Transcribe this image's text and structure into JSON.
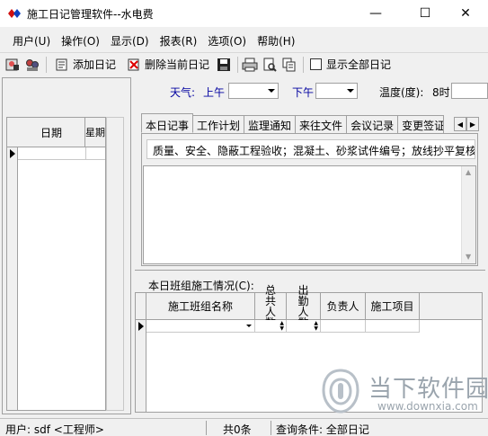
{
  "window": {
    "title": "施工日记管理软件--水电费",
    "minimize_glyph": "—",
    "maximize_glyph": "☐",
    "close_glyph": "✕"
  },
  "menu": [
    {
      "label": "用户(U)"
    },
    {
      "label": "操作(O)"
    },
    {
      "label": "显示(D)"
    },
    {
      "label": "报表(R)"
    },
    {
      "label": "选项(O)"
    },
    {
      "label": "帮助(H)"
    }
  ],
  "toolbar": {
    "add_label": "添加日记",
    "delete_label": "删除当前日记",
    "show_all_label": "显示全部日记",
    "show_all_checked": false
  },
  "left_grid": {
    "date_header": "日期",
    "week_header": "星期"
  },
  "weather": {
    "label": "天气:",
    "am_label": "上午",
    "am_value": "",
    "pm_label": "下午",
    "pm_value": "",
    "temp_label": "温度(度):",
    "temp_time": "8时"
  },
  "tabs": [
    {
      "label": "本日记事",
      "active": true
    },
    {
      "label": "工作计划",
      "active": false
    },
    {
      "label": "监理通知",
      "active": false
    },
    {
      "label": "来往文件",
      "active": false
    },
    {
      "label": "会议记录",
      "active": false
    },
    {
      "label": "变更签证",
      "active": false
    }
  ],
  "tab_content": {
    "categories": "质量、安全、隐蔽工程验收；混凝土、砂浆试件编号；放线抄平复核；",
    "notes": ""
  },
  "crew": {
    "section_label": "本日班组施工情况(C):",
    "columns": [
      "施工班组名称",
      "总共人数",
      "出勤人数",
      "负责人",
      "施工项目"
    ]
  },
  "status": {
    "user": "用户: sdf <工程师>",
    "count": "共0条",
    "query": "查询条件: 全部日记"
  },
  "watermark": {
    "brand": "当下软件园",
    "url": "www.downxia.com"
  },
  "colors": {
    "label_blue": "#0000a0",
    "watermark_gray": "#9aa4ad"
  }
}
